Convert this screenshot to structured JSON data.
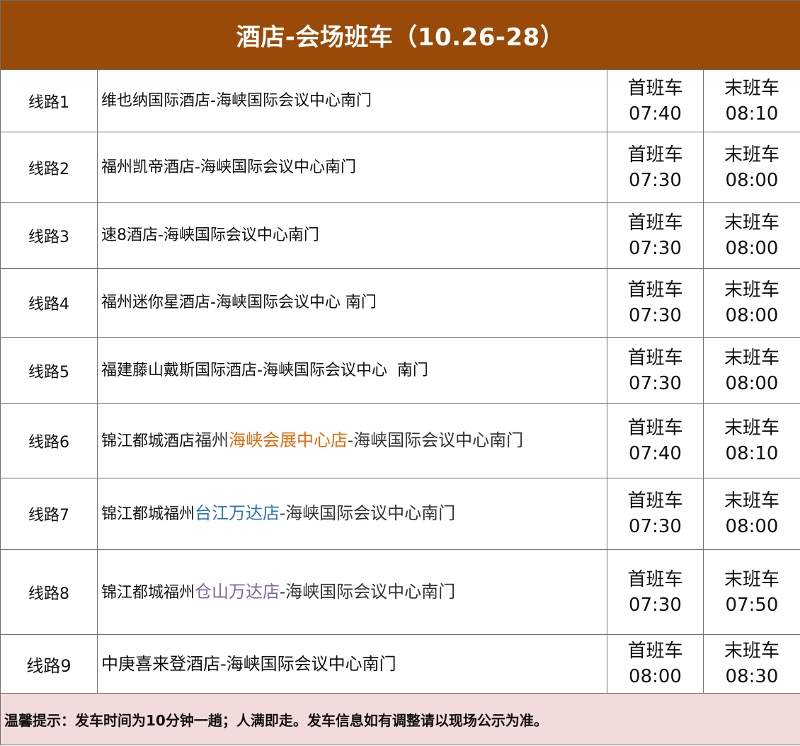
{
  "title": "酒店-会场班车（10.26-28）",
  "first_label": "首班车",
  "last_label": "末班车",
  "colors": {
    "header_bg": "#9a4a08",
    "note_bg": "#f2dcdb",
    "orange": "#e26b0a",
    "blue": "#2e75b6",
    "purple": "#8064a2"
  },
  "routes": [
    {
      "route": "线路1",
      "name": "维也纳国际酒店-海峡国际会议中心南门",
      "first": "07:40",
      "last": "08:10"
    },
    {
      "route": "线路2",
      "name": "福州凯帝酒店-海峡国际会议中心南门",
      "first": "07:30",
      "last": "08:00"
    },
    {
      "route": "线路3",
      "name": "速8酒店-海峡国际会议中心南门",
      "first": "07:30",
      "last": "08:00"
    },
    {
      "route": "线路4",
      "name": "福州迷你星酒店-海峡国际会议中心 南门",
      "first": "07:30",
      "last": "08:00"
    },
    {
      "route": "线路5",
      "name": "福建藤山戴斯国际酒店-海峡国际会议中心  南门",
      "first": "07:30",
      "last": "08:00"
    },
    {
      "route": "线路6",
      "name_pre": "锦江都城酒店",
      "name_serif": "福州",
      "name_hl": "海峡会展中心店",
      "name_post": "-海峡国际会议中心南门",
      "first": "07:40",
      "last": "08:10"
    },
    {
      "route": "线路7",
      "name_pre": "锦江都城福州",
      "name_hl": "台江万达店",
      "name_post": "-海峡国际会议中心南门",
      "first": "07:30",
      "last": "08:00"
    },
    {
      "route": "线路8",
      "name_pre": "锦江都城福州",
      "name_hl": "仓山万达店",
      "name_post": "-海峡国际会议中心南门",
      "first": "07:30",
      "last": "07:50"
    },
    {
      "route": "线路9",
      "name": "中庚喜来登酒店-海峡国际会议中心南门",
      "first": "08:00",
      "last": "08:30"
    }
  ],
  "note": "温馨提示：发车时间为10分钟一趟；人满即走。发车信息如有调整请以现场公示为准。"
}
